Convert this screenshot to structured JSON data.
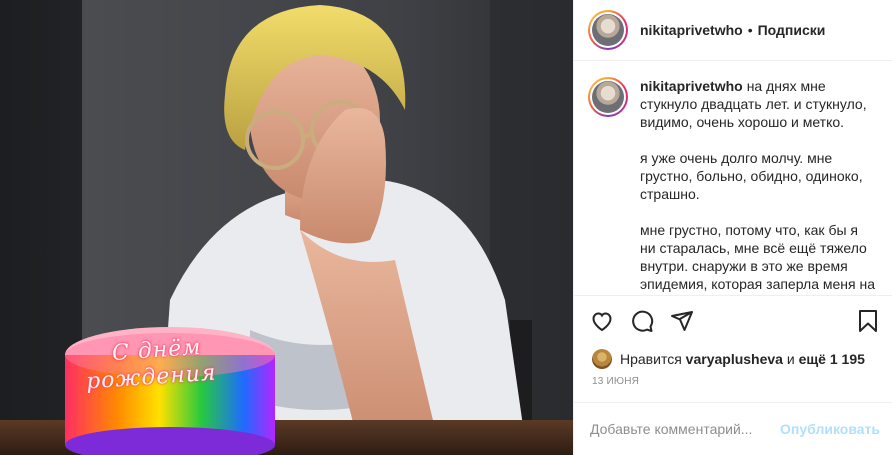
{
  "post": {
    "author": "nikitaprivetwho",
    "follow_status": "Подписки",
    "separator": "•",
    "photo": {
      "cake_text_line1": "С днём",
      "cake_text_line2": "рождения"
    },
    "caption": {
      "username": "nikitaprivetwho",
      "paragraph1": "на днях мне стукнуло двадцать лет. и стукнуло, видимо, очень хорошо и метко.",
      "paragraph2": "я уже очень долго молчу. мне грустно, больно, обидно, одиноко, страшно.",
      "paragraph3": "мне грустно, потому что, как бы я ни старалась, мне всё ещё тяжело внутри. снаружи в это же время эпидемия, которая заперла меня на два с половиной месяца с людьми,"
    },
    "actions": {
      "like_icon": "heart-icon",
      "comment_icon": "comment-icon",
      "share_icon": "share-icon",
      "save_icon": "bookmark-icon"
    },
    "likes": {
      "prefix": "Нравится",
      "liker": "varyaplusheva",
      "middle": "и",
      "more": "ещё 1 195"
    },
    "date": "13 июня",
    "comment_box": {
      "placeholder": "Добавьте комментарий...",
      "publish_label": "Опубликовать"
    },
    "colors": {
      "link_disabled": "#b2dffc",
      "text": "#262626",
      "secondary": "#8e8e8e"
    }
  }
}
